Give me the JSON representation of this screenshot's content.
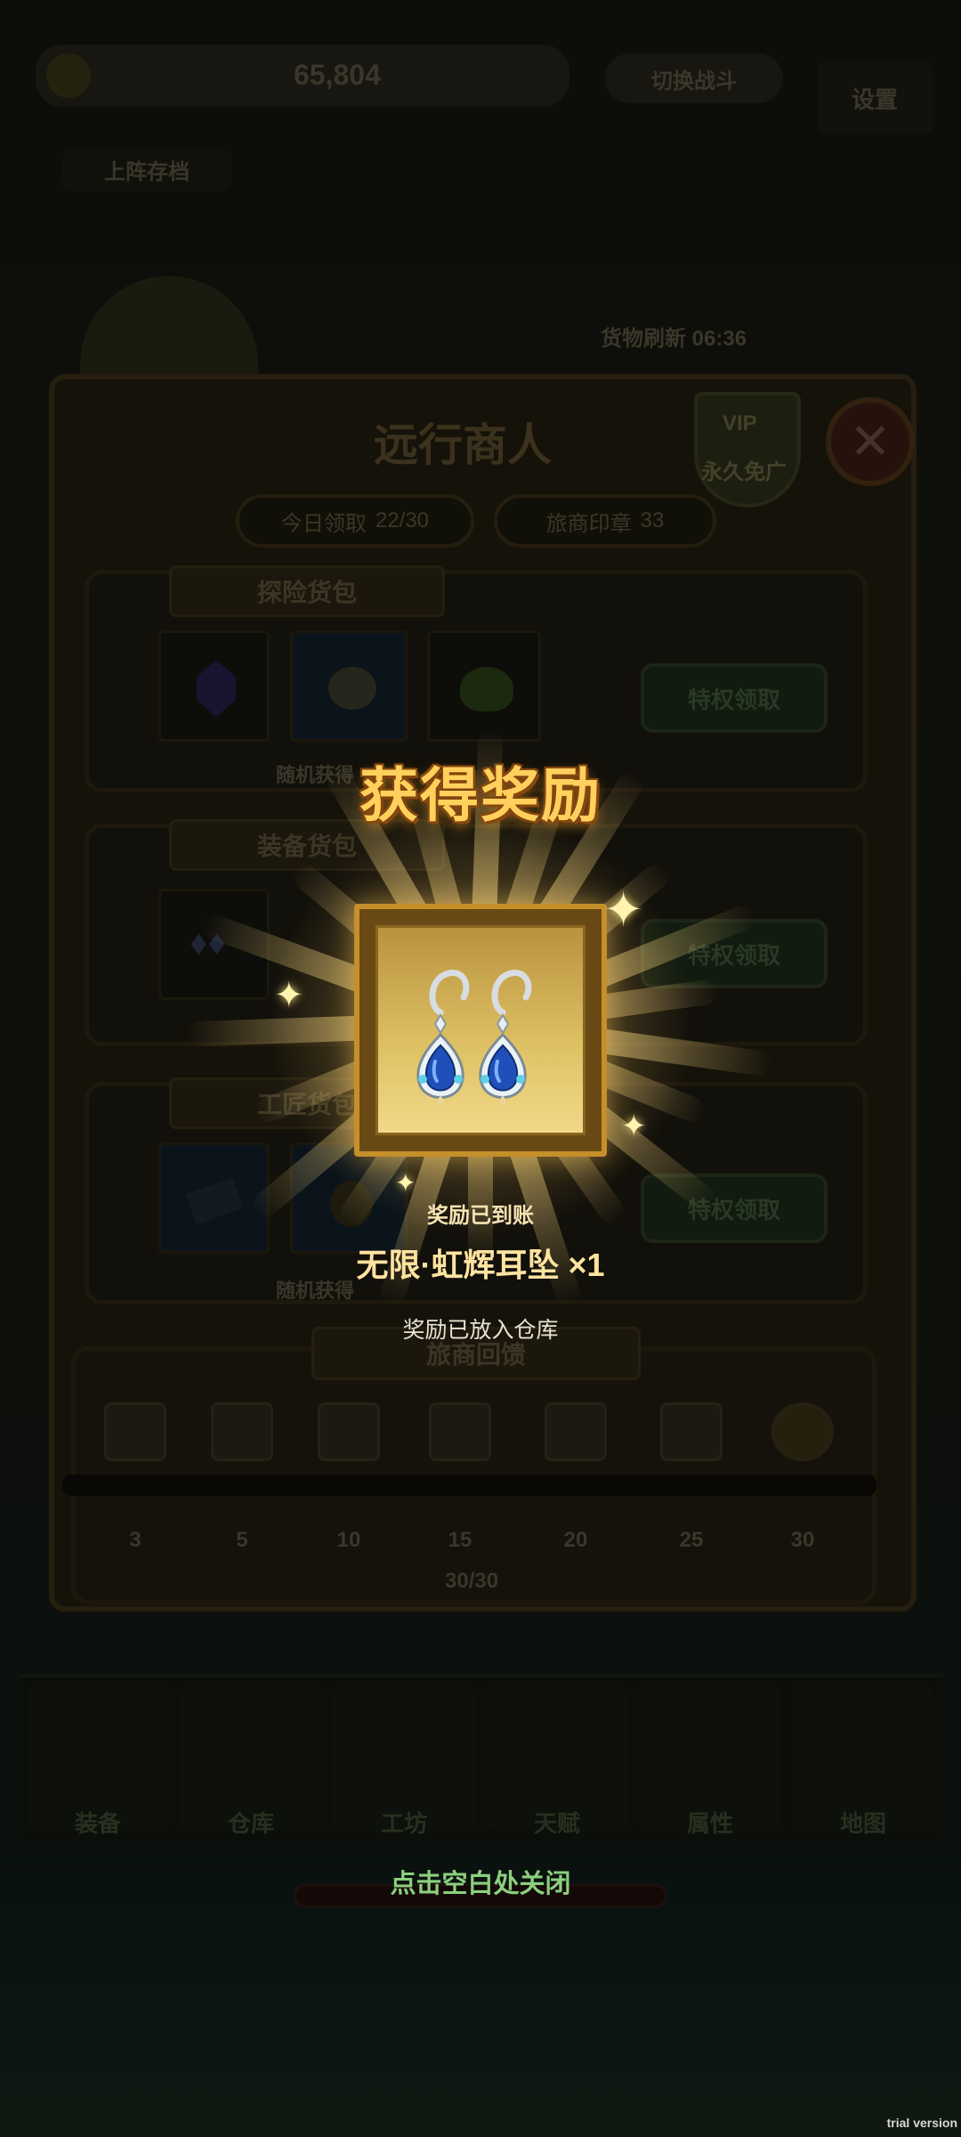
{
  "hud": {
    "currency_amount": "65,804",
    "switch_battle_label": "切换战斗",
    "settings_label": "设置",
    "region_label": "上阵存档"
  },
  "merchant": {
    "refresh_label": "货物刷新 06:36",
    "title": "远行商人",
    "vip_badge": "VIP",
    "vip_caption": "永久免广",
    "today_claimed_label": "今日领取",
    "today_claimed_value": "22/30",
    "seal_label": "旅商印章",
    "seal_value": "33",
    "packs": [
      {
        "name": "探险货包",
        "footer": "随机获得",
        "button": "特权领取"
      },
      {
        "name": "装备货包",
        "footer": "随机获得",
        "button": "特权领取"
      },
      {
        "name": "工匠货包",
        "footer": "随机获得",
        "button": "特权领取"
      }
    ],
    "rebate": {
      "title": "旅商回馈",
      "milestones": [
        "3",
        "5",
        "10",
        "15",
        "20",
        "25",
        "30"
      ],
      "progress_text": "30/30",
      "progress": 1.0
    }
  },
  "bottom_nav": {
    "items": [
      "装备",
      "仓库",
      "工坊",
      "天赋",
      "属性",
      "地图"
    ]
  },
  "reward_popup": {
    "title": "获得奖励",
    "received_label": "奖励已到账",
    "item_name": "无限·虹辉耳坠",
    "item_count": "×1",
    "stored_note": "奖励已放入仓库",
    "item_icon": "sapphire-earrings-icon",
    "close_hint": "点击空白处关闭"
  },
  "watermark": "trial version",
  "colors": {
    "title_gold": "#ffd15c",
    "card_border": "#c58f2a",
    "sapphire": "#1f4fb8",
    "close_hint_green": "#8ccf7e"
  }
}
